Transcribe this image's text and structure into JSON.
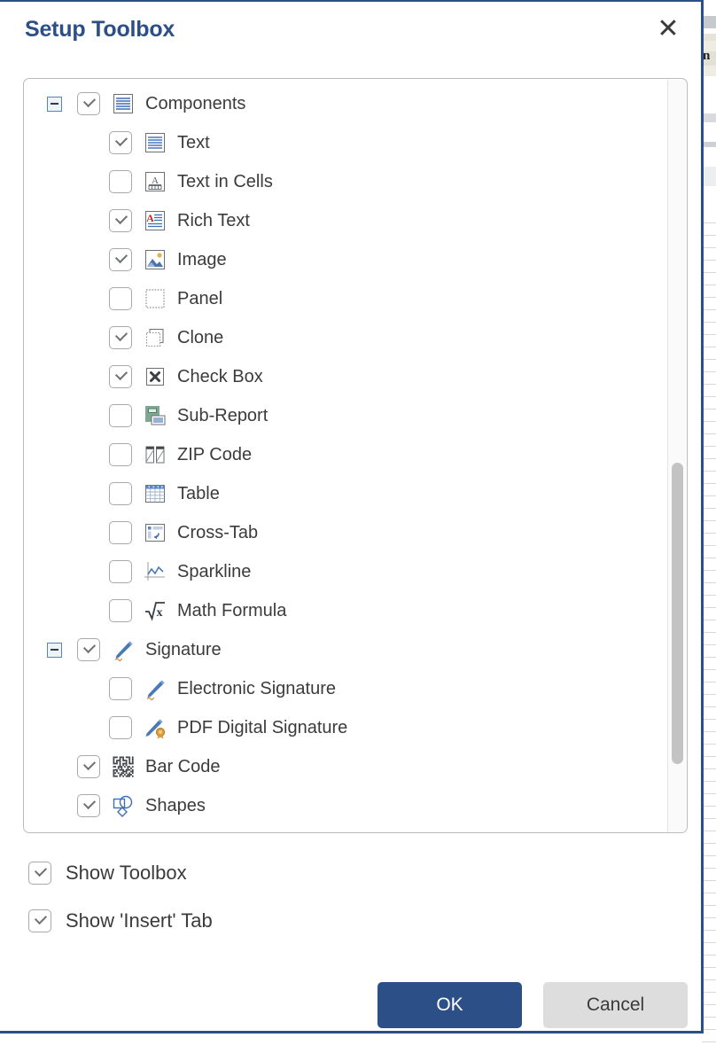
{
  "dialog": {
    "title": "Setup Toolbox",
    "close_label": "✕",
    "close_icon": "close-icon"
  },
  "tree": {
    "items": [
      {
        "label": "Components",
        "icon": "text-lines-icon",
        "checked": true,
        "level": 0,
        "expander": "minus"
      },
      {
        "label": "Text",
        "icon": "text-lines-icon",
        "checked": true,
        "level": 1,
        "expander": "none"
      },
      {
        "label": "Text in Cells",
        "icon": "text-in-cells-icon",
        "checked": false,
        "level": 1,
        "expander": "none"
      },
      {
        "label": "Rich Text",
        "icon": "rich-text-icon",
        "checked": true,
        "level": 1,
        "expander": "none"
      },
      {
        "label": "Image",
        "icon": "image-icon",
        "checked": true,
        "level": 1,
        "expander": "none"
      },
      {
        "label": "Panel",
        "icon": "panel-icon",
        "checked": false,
        "level": 1,
        "expander": "none"
      },
      {
        "label": "Clone",
        "icon": "clone-icon",
        "checked": true,
        "level": 1,
        "expander": "none"
      },
      {
        "label": "Check Box",
        "icon": "check-box-icon",
        "checked": true,
        "level": 1,
        "expander": "none"
      },
      {
        "label": "Sub-Report",
        "icon": "sub-report-icon",
        "checked": false,
        "level": 1,
        "expander": "none"
      },
      {
        "label": "ZIP Code",
        "icon": "zip-code-icon",
        "checked": false,
        "level": 1,
        "expander": "none"
      },
      {
        "label": "Table",
        "icon": "table-icon",
        "checked": false,
        "level": 1,
        "expander": "none"
      },
      {
        "label": "Cross-Tab",
        "icon": "cross-tab-icon",
        "checked": false,
        "level": 1,
        "expander": "none"
      },
      {
        "label": "Sparkline",
        "icon": "sparkline-icon",
        "checked": false,
        "level": 1,
        "expander": "none"
      },
      {
        "label": "Math Formula",
        "icon": "math-formula-icon",
        "checked": false,
        "level": 1,
        "expander": "none"
      },
      {
        "label": "Signature",
        "icon": "signature-icon",
        "checked": true,
        "level": 0,
        "expander": "minus"
      },
      {
        "label": "Electronic Signature",
        "icon": "signature-icon",
        "checked": false,
        "level": 1,
        "expander": "none"
      },
      {
        "label": "PDF Digital Signature",
        "icon": "pdf-signature-icon",
        "checked": false,
        "level": 1,
        "expander": "none"
      },
      {
        "label": "Bar Code",
        "icon": "bar-code-icon",
        "checked": true,
        "level": 0,
        "expander": "none"
      },
      {
        "label": "Shapes",
        "icon": "shapes-icon",
        "checked": true,
        "level": 0,
        "expander": "none"
      }
    ]
  },
  "options": [
    {
      "label": "Show Toolbox",
      "checked": true
    },
    {
      "label": "Show 'Insert' Tab",
      "checked": true
    }
  ],
  "footer": {
    "ok_label": "OK",
    "cancel_label": "Cancel"
  },
  "colors": {
    "accent": "#2d4f88",
    "dialog_border": "#2d4f88",
    "panel_border": "#b9bbbe",
    "text": "#3b3b3b",
    "cancel_bg": "#dddddd",
    "scrollbar_thumb": "#c3c3c3"
  }
}
